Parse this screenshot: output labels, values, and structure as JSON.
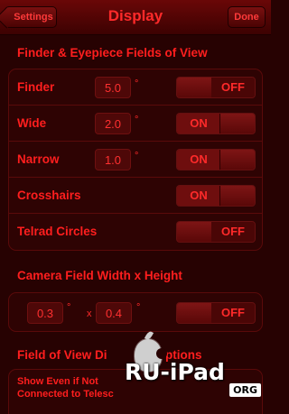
{
  "navbar": {
    "back_label": "Settings",
    "title": "Display",
    "done_label": "Done"
  },
  "finder_section": {
    "title": "Finder & Eyepiece Fields of View",
    "rows": [
      {
        "label": "Finder",
        "value": "5.0",
        "unit": "°",
        "toggle": "OFF"
      },
      {
        "label": "Wide",
        "value": "2.0",
        "unit": "°",
        "toggle": "ON"
      },
      {
        "label": "Narrow",
        "value": "1.0",
        "unit": "°",
        "toggle": "ON"
      },
      {
        "label": "Crosshairs",
        "toggle": "ON"
      },
      {
        "label": "Telrad Circles",
        "toggle": "OFF"
      }
    ]
  },
  "camera_section": {
    "title": "Camera Field Width x Height",
    "width": "0.3",
    "height": "0.4",
    "unit": "°",
    "separator": "x",
    "toggle": "OFF"
  },
  "fov_section": {
    "title": "Field of View Di",
    "title_tail": "Options",
    "row_line1": "Show Even if Not",
    "row_line2": "Connected to Telesc"
  },
  "watermark": {
    "text": "RU-iPad",
    "badge": "ORG"
  },
  "colors": {
    "background": "#270202",
    "text": "#ff1e1e",
    "navbar": "#5a0505"
  }
}
